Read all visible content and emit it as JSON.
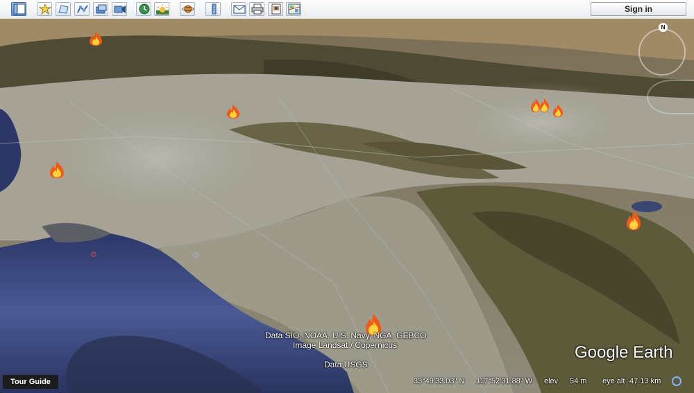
{
  "toolbar": {
    "buttons": [
      {
        "name": "sidebar-toggle-icon"
      },
      {
        "name": "add-placemark-icon"
      },
      {
        "name": "add-polygon-icon"
      },
      {
        "name": "add-path-icon"
      },
      {
        "name": "add-overlay-icon"
      },
      {
        "name": "record-tour-icon"
      },
      {
        "name": "historical-imagery-icon"
      },
      {
        "name": "sunlight-icon"
      },
      {
        "name": "planets-icon"
      },
      {
        "name": "ruler-icon"
      },
      {
        "name": "email-icon"
      },
      {
        "name": "print-icon"
      },
      {
        "name": "save-image-icon"
      },
      {
        "name": "view-in-maps-icon"
      }
    ],
    "sign_in_label": "Sign in"
  },
  "map": {
    "credits": {
      "line1": "Data SIO, NOAA, U.S. Navy, NGA, GEBCO",
      "line2": "Image Landsat / Copernicus",
      "line3": "Data USGS"
    },
    "logo": "Google Earth",
    "compass_label": "N",
    "fire_markers": [
      {
        "name": "fire-marker"
      },
      {
        "name": "fire-marker"
      },
      {
        "name": "fire-marker"
      },
      {
        "name": "fire-marker"
      },
      {
        "name": "fire-marker"
      },
      {
        "name": "fire-marker"
      },
      {
        "name": "fire-marker"
      }
    ]
  },
  "tour_guide_label": "Tour Guide",
  "status": {
    "latitude": "33°49'33.03\" N",
    "longitude": "117°52'31.88\" W",
    "elev_label": "elev",
    "elev_value": "54 m",
    "eye_alt_label": "eye alt",
    "eye_alt_value": "47.13 km"
  },
  "colors": {
    "ocean": "#3f4f86",
    "land": "#8a8676",
    "mountains": "#5f5a3f",
    "urban": "#a9a79e"
  }
}
